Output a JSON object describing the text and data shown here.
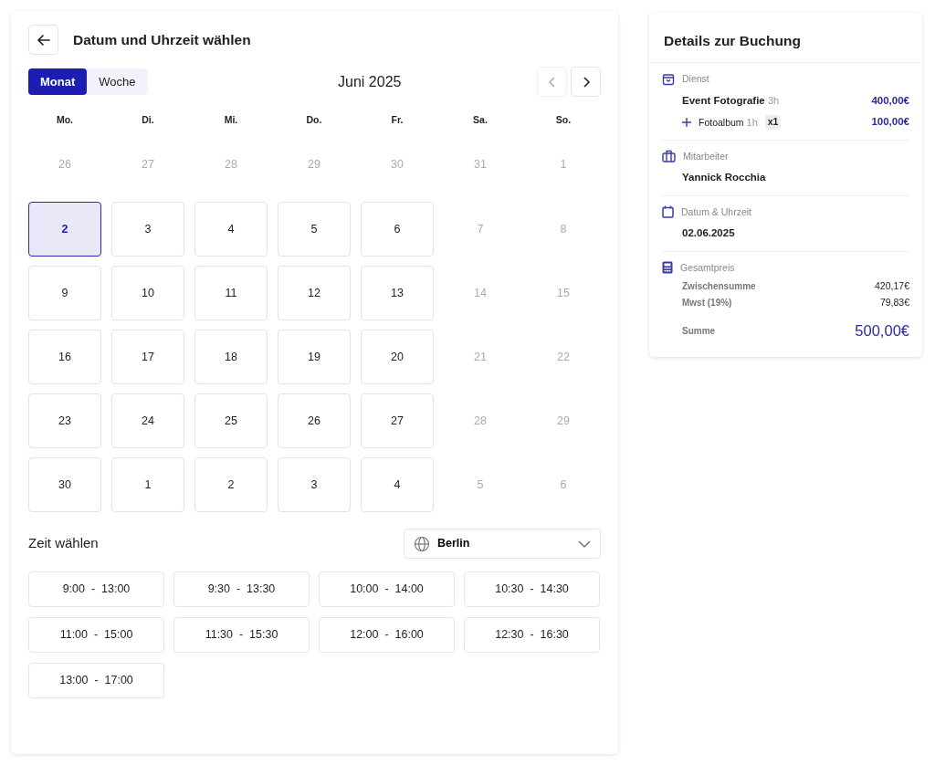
{
  "header": {
    "title": "Datum und Uhrzeit wählen"
  },
  "view_tabs": [
    {
      "label": "Monat",
      "selected": true
    },
    {
      "label": "Woche",
      "selected": false
    }
  ],
  "calendar": {
    "month": "Juni 2025",
    "prev_disabled": true,
    "weekdays": [
      "Mo.",
      "Di.",
      "Mi.",
      "Do.",
      "Fr.",
      "Sa.",
      "So."
    ],
    "weeks": [
      [
        {
          "label": "26",
          "kind": "outside",
          "selected": false
        },
        {
          "label": "27",
          "kind": "outside",
          "selected": false
        },
        {
          "label": "28",
          "kind": "outside",
          "selected": false
        },
        {
          "label": "29",
          "kind": "outside",
          "selected": false
        },
        {
          "label": "30",
          "kind": "outside",
          "selected": false
        },
        {
          "label": "31",
          "kind": "outside",
          "selected": false
        },
        {
          "label": "1",
          "kind": "outside",
          "selected": false
        }
      ],
      [
        {
          "label": "2",
          "kind": "available",
          "selected": true
        },
        {
          "label": "3",
          "kind": "available",
          "selected": false
        },
        {
          "label": "4",
          "kind": "available",
          "selected": false
        },
        {
          "label": "5",
          "kind": "available",
          "selected": false
        },
        {
          "label": "6",
          "kind": "available",
          "selected": false
        },
        {
          "label": "7",
          "kind": "unavailable",
          "selected": false
        },
        {
          "label": "8",
          "kind": "unavailable",
          "selected": false
        }
      ],
      [
        {
          "label": "9",
          "kind": "available",
          "selected": false
        },
        {
          "label": "10",
          "kind": "available",
          "selected": false
        },
        {
          "label": "11",
          "kind": "available",
          "selected": false
        },
        {
          "label": "12",
          "kind": "available",
          "selected": false
        },
        {
          "label": "13",
          "kind": "available",
          "selected": false
        },
        {
          "label": "14",
          "kind": "unavailable",
          "selected": false
        },
        {
          "label": "15",
          "kind": "unavailable",
          "selected": false
        }
      ],
      [
        {
          "label": "16",
          "kind": "available",
          "selected": false
        },
        {
          "label": "17",
          "kind": "available",
          "selected": false
        },
        {
          "label": "18",
          "kind": "available",
          "selected": false
        },
        {
          "label": "19",
          "kind": "available",
          "selected": false
        },
        {
          "label": "20",
          "kind": "available",
          "selected": false
        },
        {
          "label": "21",
          "kind": "unavailable",
          "selected": false
        },
        {
          "label": "22",
          "kind": "unavailable",
          "selected": false
        }
      ],
      [
        {
          "label": "23",
          "kind": "available",
          "selected": false
        },
        {
          "label": "24",
          "kind": "available",
          "selected": false
        },
        {
          "label": "25",
          "kind": "available",
          "selected": false
        },
        {
          "label": "26",
          "kind": "available",
          "selected": false
        },
        {
          "label": "27",
          "kind": "available",
          "selected": false
        },
        {
          "label": "28",
          "kind": "unavailable",
          "selected": false
        },
        {
          "label": "29",
          "kind": "unavailable",
          "selected": false
        }
      ],
      [
        {
          "label": "30",
          "kind": "available",
          "selected": false
        },
        {
          "label": "1",
          "kind": "available",
          "selected": false
        },
        {
          "label": "2",
          "kind": "available",
          "selected": false
        },
        {
          "label": "3",
          "kind": "available",
          "selected": false
        },
        {
          "label": "4",
          "kind": "available",
          "selected": false
        },
        {
          "label": "5",
          "kind": "unavailable",
          "selected": false
        },
        {
          "label": "6",
          "kind": "unavailable",
          "selected": false
        }
      ]
    ]
  },
  "time": {
    "title": "Zeit wählen",
    "timezone": "Berlin",
    "slots": [
      {
        "label": "9:00  -  13:00",
        "selected": false
      },
      {
        "label": "9:30  -  13:30",
        "selected": false
      },
      {
        "label": "10:00  -  14:00",
        "selected": false
      },
      {
        "label": "10:30  -  14:30",
        "selected": false
      },
      {
        "label": "11:00  -  15:00",
        "selected": false
      },
      {
        "label": "11:30  -  15:30",
        "selected": false
      },
      {
        "label": "12:00  -  16:00",
        "selected": false
      },
      {
        "label": "12:30  -  16:30",
        "selected": false
      },
      {
        "label": "13:00  -  17:00",
        "selected": false
      }
    ]
  },
  "details": {
    "title": "Details zur Buchung",
    "service": {
      "label": "Dienst",
      "name": "Event Fotografie",
      "duration": "3h",
      "price": "400,00€",
      "extras": [
        {
          "name": "Fotoalbum",
          "duration": "1h",
          "quantity": "x1",
          "price": "100,00€"
        }
      ]
    },
    "employee": {
      "label": "Mitarbeiter",
      "name": "Yannick Rocchia"
    },
    "datetime": {
      "label": "Datum & Uhrzeit",
      "value": "02.06.2025"
    },
    "total": {
      "label": "Gesamtpreis",
      "lines": [
        {
          "label": "Zwischensumme",
          "value": "420,17€"
        },
        {
          "label": "Mwst (19%)",
          "value": "79,83€"
        }
      ],
      "sum_label": "Summe",
      "sum_value": "500,00€"
    }
  }
}
